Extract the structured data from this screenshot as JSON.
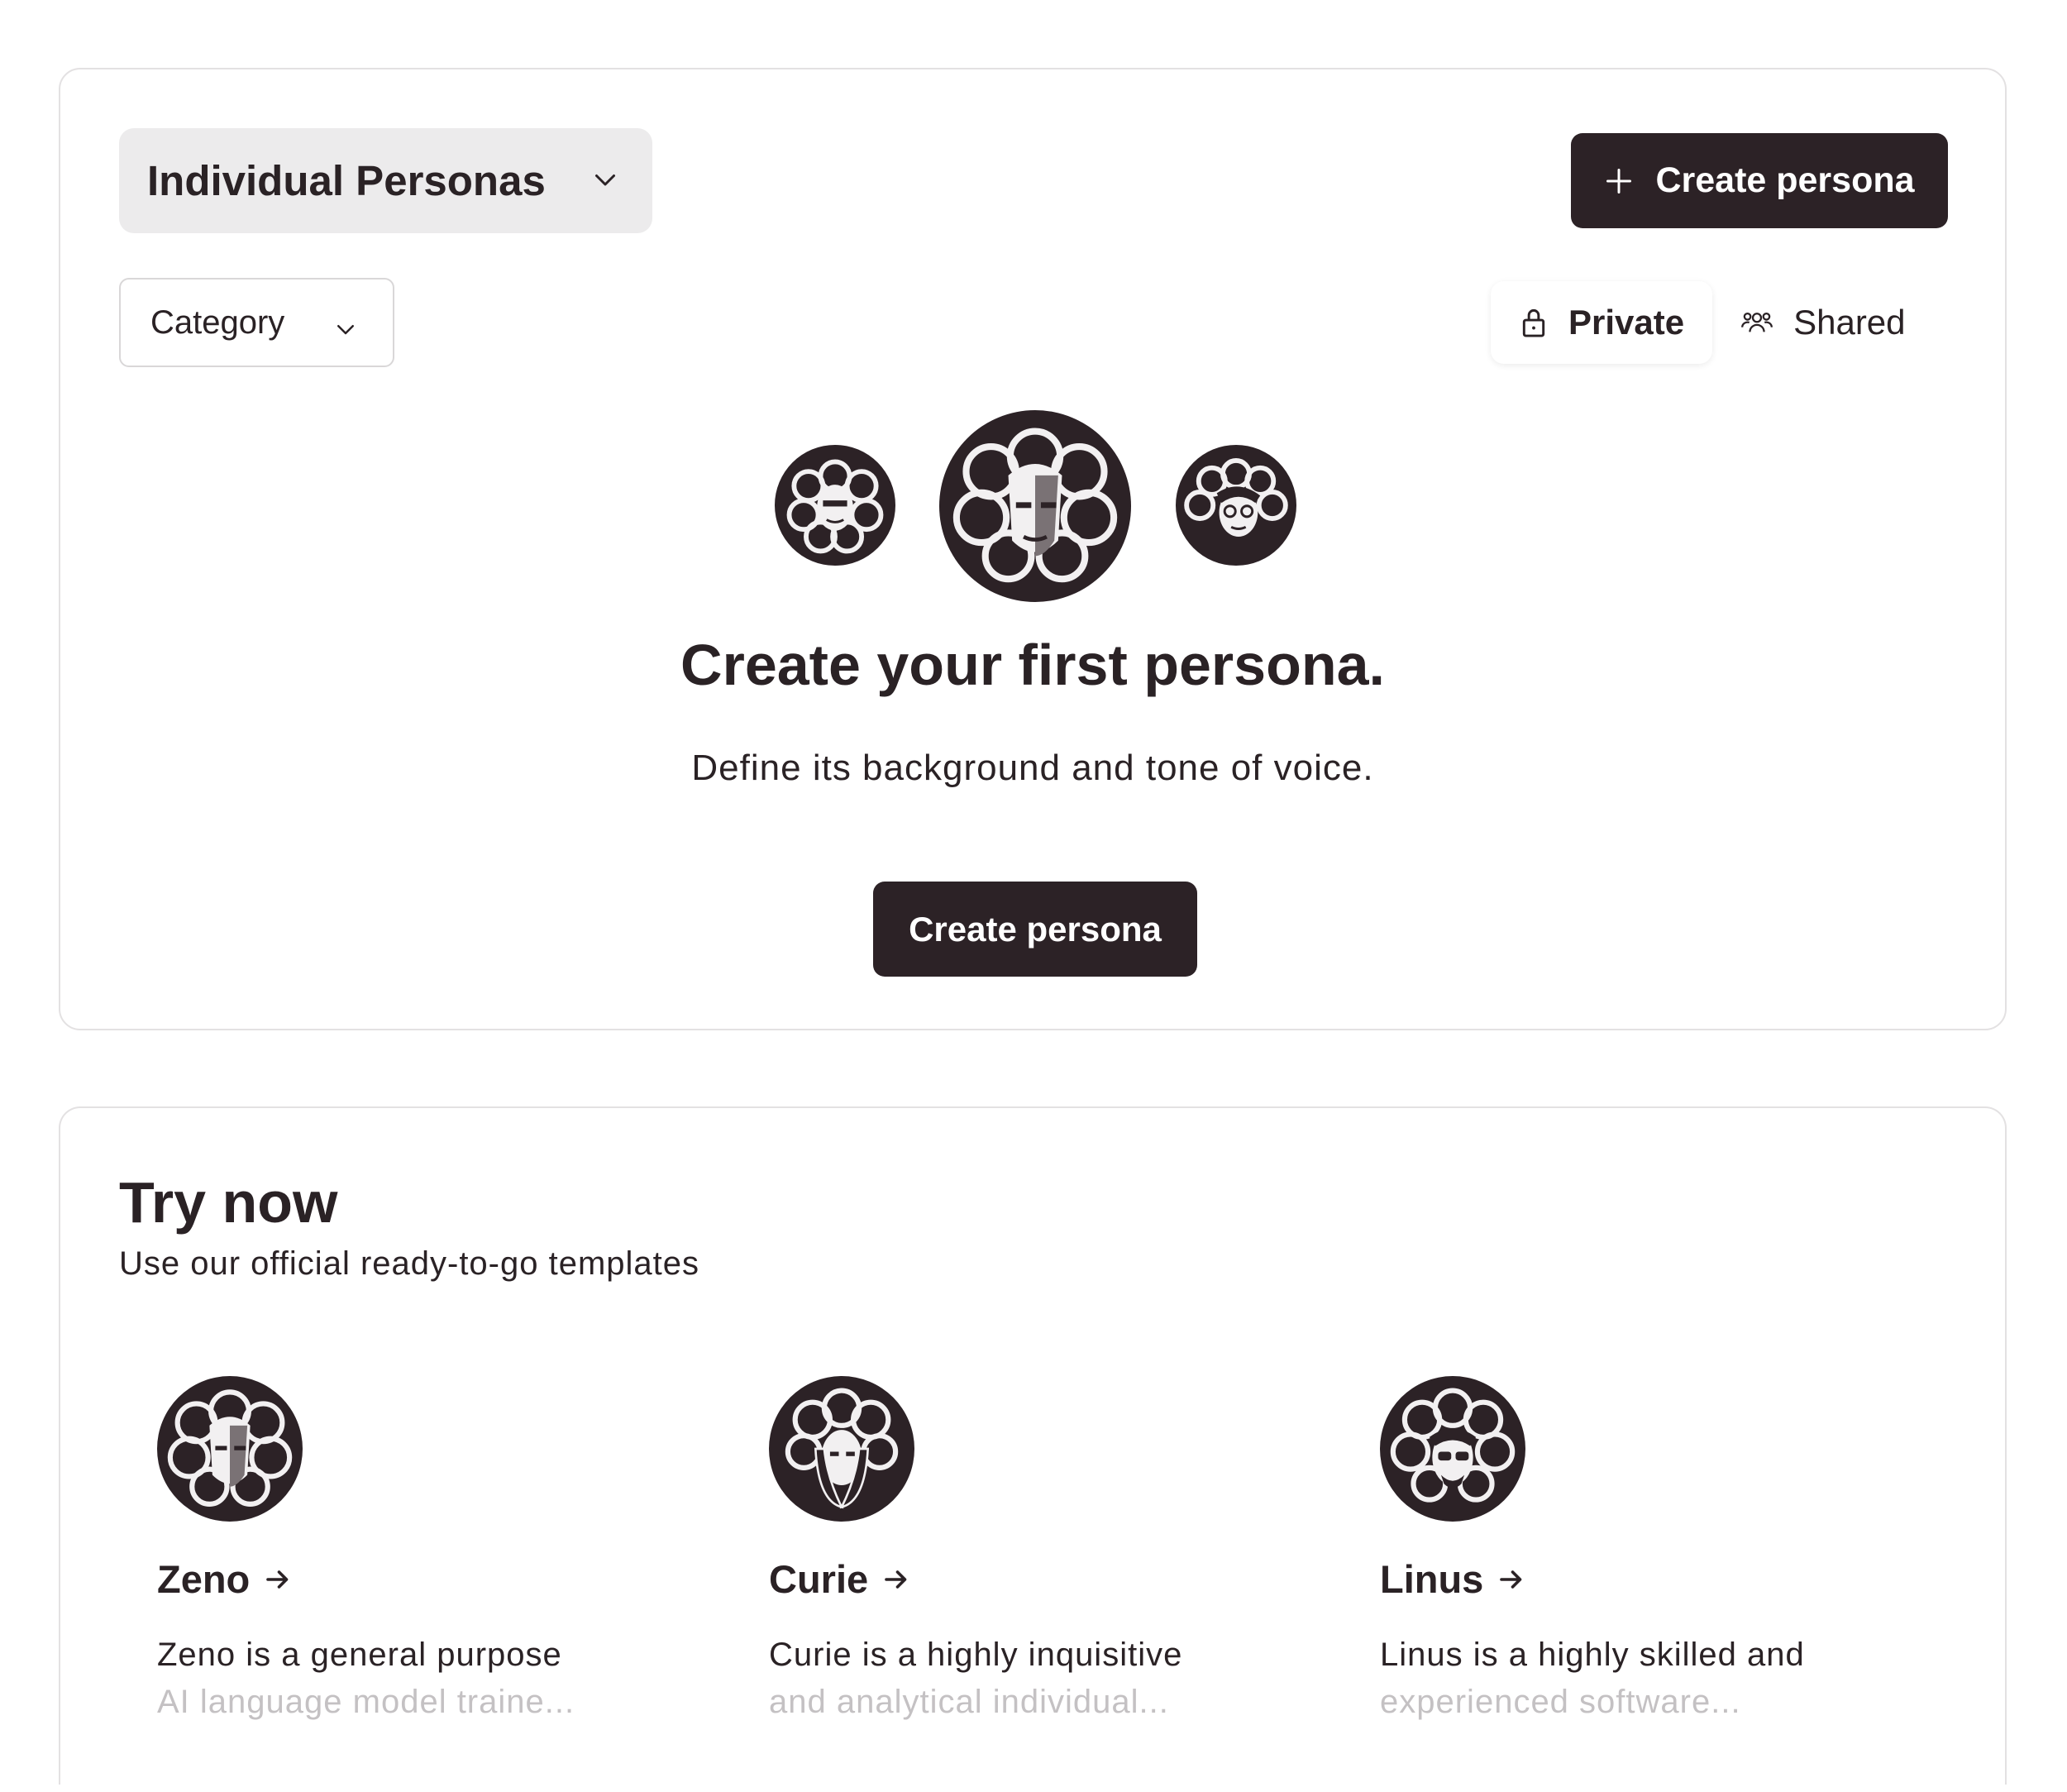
{
  "personas": {
    "type_select_label": "Individual Personas",
    "create_button_label": "Create persona",
    "category_label": "Category",
    "visibility": {
      "private_label": "Private",
      "shared_label": "Shared",
      "active": "private"
    },
    "empty_state": {
      "title": "Create your first persona.",
      "subtitle": "Define its background and tone of voice.",
      "button_label": "Create persona"
    }
  },
  "try_now": {
    "title": "Try now",
    "subtitle": "Use our official ready-to-go templates",
    "templates": [
      {
        "name": "Zeno",
        "desc_line1": "Zeno is a general purpose",
        "desc_line2": "AI language model traine..."
      },
      {
        "name": "Curie",
        "desc_line1": "Curie is a highly inquisitive",
        "desc_line2": "and analytical individual..."
      },
      {
        "name": "Linus",
        "desc_line1": "Linus is a highly skilled and",
        "desc_line2": "experienced software..."
      }
    ]
  },
  "colors": {
    "primary_dark": "#2c2226",
    "text": "#2a2225",
    "muted_text": "#c4c1c3",
    "select_bg": "#ecebec",
    "border": "#e3e1e2"
  },
  "icons": [
    "chevron-down-icon",
    "plus-icon",
    "lock-icon",
    "users-icon",
    "arrow-right-icon",
    "persona-avatar-icon"
  ]
}
